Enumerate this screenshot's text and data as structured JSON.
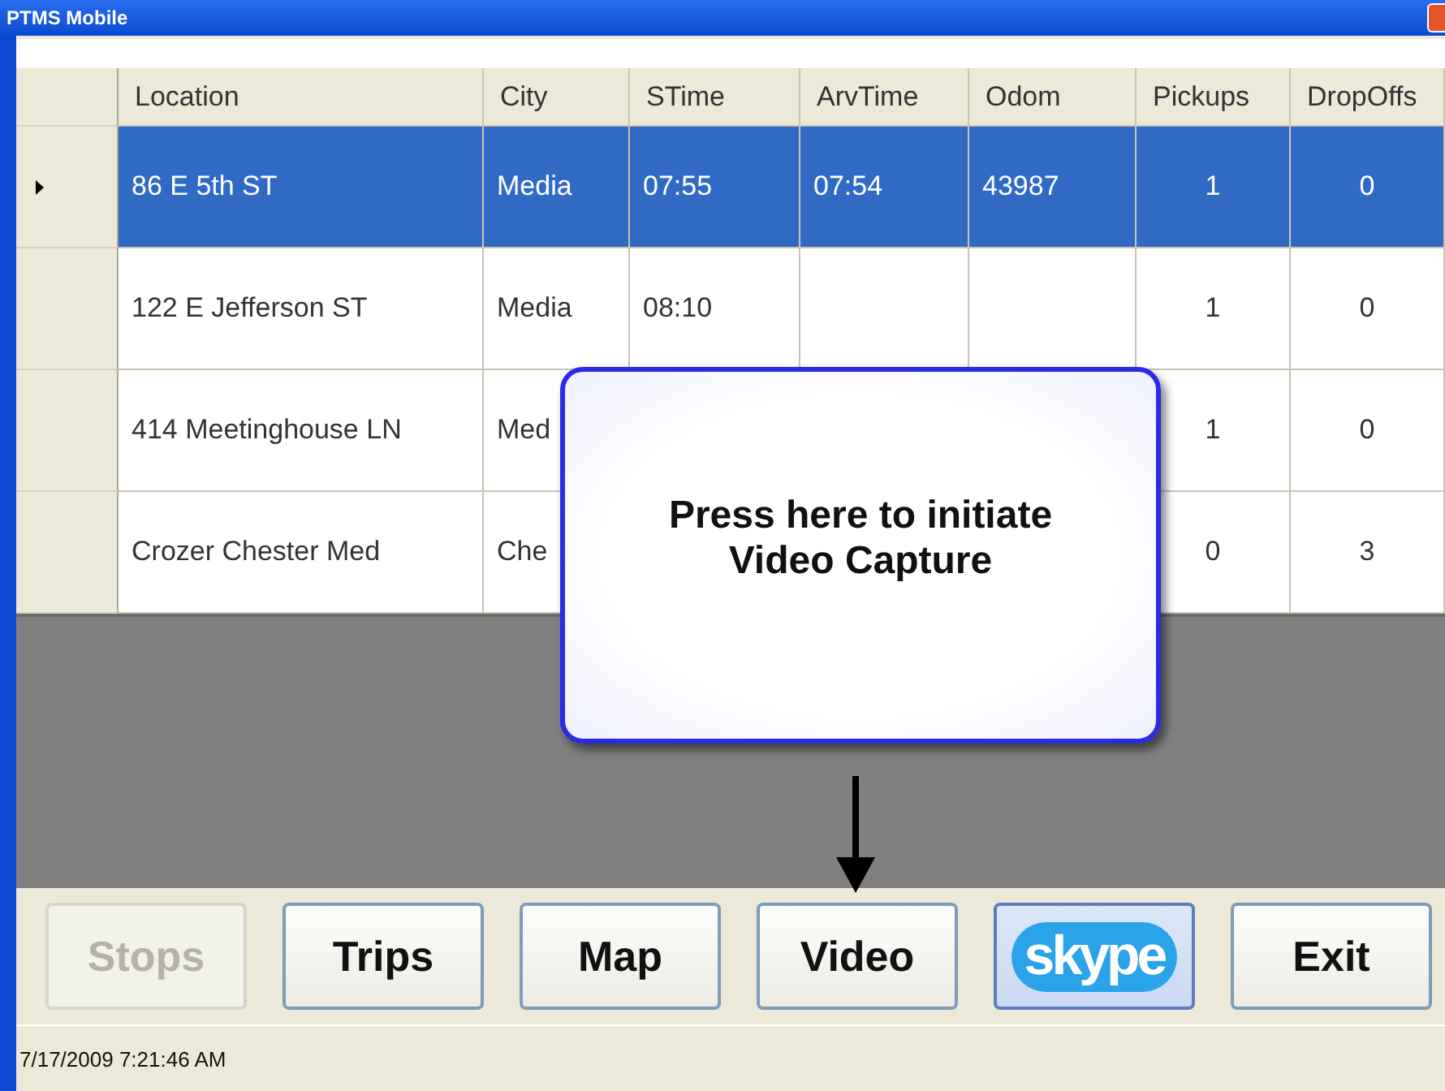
{
  "window": {
    "title": "PTMS Mobile"
  },
  "table": {
    "columns": [
      "Location",
      "City",
      "STime",
      "ArvTime",
      "Odom",
      "Pickups",
      "DropOffs"
    ],
    "rows": [
      {
        "selected": true,
        "cells": [
          "86 E 5th ST",
          "Media",
          "07:55",
          "07:54",
          "43987",
          "1",
          "0"
        ]
      },
      {
        "selected": false,
        "cells": [
          "122 E Jefferson ST",
          "Media",
          "08:10",
          "",
          "",
          "1",
          "0"
        ]
      },
      {
        "selected": false,
        "cells": [
          "414 Meetinghouse LN",
          "Med",
          "",
          "",
          "",
          "1",
          "0"
        ]
      },
      {
        "selected": false,
        "cells": [
          "Crozer Chester Med",
          "Che",
          "",
          "",
          "",
          "0",
          "3"
        ]
      }
    ]
  },
  "callout": {
    "text": "Press here to initiate Video Capture"
  },
  "buttons": [
    {
      "kind": "text",
      "label": "Stops",
      "disabled": true
    },
    {
      "kind": "text",
      "label": "Trips",
      "disabled": false
    },
    {
      "kind": "text",
      "label": "Map",
      "disabled": false
    },
    {
      "kind": "text",
      "label": "Video",
      "disabled": false
    },
    {
      "kind": "logo",
      "label": "skype",
      "disabled": false
    },
    {
      "kind": "text",
      "label": "Exit",
      "disabled": false
    }
  ],
  "status_bar": "7/17/2009 7:21:46 AM"
}
